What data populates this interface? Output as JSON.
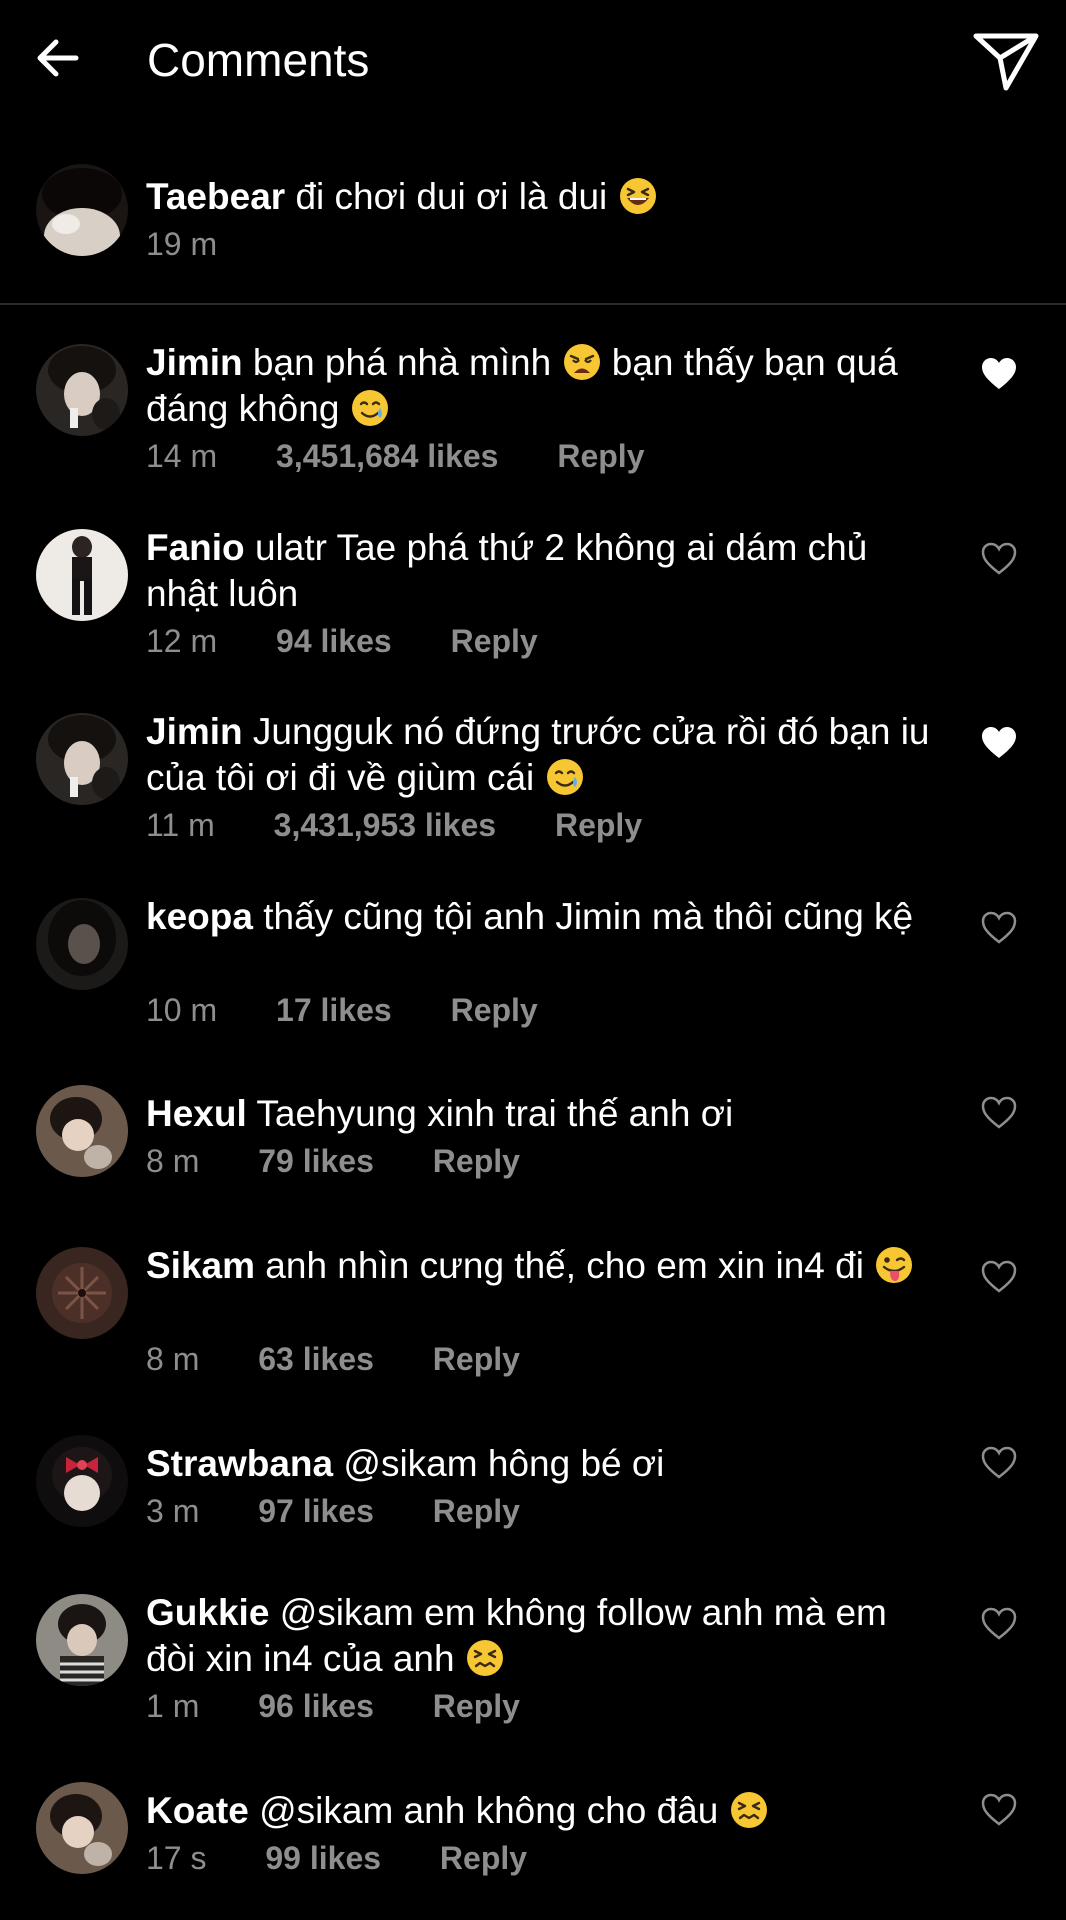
{
  "header": {
    "title": "Comments"
  },
  "caption": {
    "username": "Taebear",
    "text": "đi chơi dui ơi là dui",
    "emoji": "laughing-squint-emoji",
    "time": "19 m"
  },
  "comments": [
    {
      "username": "Jimin",
      "parts": [
        "bạn phá nhà mình",
        "bạn thấy bạn quá đáng không"
      ],
      "emojis": [
        "weary-emoji",
        "smiling-tear-emoji"
      ],
      "time": "14 m",
      "likes": "3,451,684 likes",
      "reply": "Reply",
      "liked": true
    },
    {
      "username": "Fanio",
      "parts": [
        "ulatr Tae phá thứ 2 không ai dám chủ nhật luôn"
      ],
      "emojis": [],
      "time": "12 m",
      "likes": "94 likes",
      "reply": "Reply",
      "liked": false
    },
    {
      "username": "Jimin",
      "parts": [
        "Jungguk nó đứng trước cửa rồi đó bạn iu của tôi ơi đi về giùm cái"
      ],
      "emojis": [
        "smiling-tear-emoji"
      ],
      "time": "11 m",
      "likes": "3,431,953 likes",
      "reply": "Reply",
      "liked": true
    },
    {
      "username": "keopa",
      "parts": [
        "thấy cũng tội anh Jimin mà thôi cũng kệ"
      ],
      "emojis": [],
      "time": "10 m",
      "likes": "17 likes",
      "reply": "Reply",
      "liked": false
    },
    {
      "username": "Hexul",
      "parts": [
        "Taehyung xinh trai thế anh ơi"
      ],
      "emojis": [],
      "time": "8 m",
      "likes": "79 likes",
      "reply": "Reply",
      "liked": false
    },
    {
      "username": "Sikam",
      "parts": [
        "anh nhìn cưng thế, cho em xin in4 đi"
      ],
      "emojis": [
        "tongue-wink-emoji"
      ],
      "time": "8 m",
      "likes": "63 likes",
      "reply": "Reply",
      "liked": false
    },
    {
      "username": "Strawbana",
      "parts": [
        "@sikam hông bé ơi"
      ],
      "emojis": [],
      "time": "3 m",
      "likes": "97 likes",
      "reply": "Reply",
      "liked": false
    },
    {
      "username": "Gukkie",
      "parts": [
        "@sikam em không follow anh mà em đòi xin in4 của anh"
      ],
      "emojis": [
        "confounded-emoji"
      ],
      "time": "1 m",
      "likes": "96 likes",
      "reply": "Reply",
      "liked": false
    },
    {
      "username": "Koate",
      "parts": [
        "@sikam anh không cho đâu"
      ],
      "emojis": [
        "confounded-emoji"
      ],
      "time": "17 s",
      "likes": "99 likes",
      "reply": "Reply",
      "liked": false
    }
  ],
  "colors": {
    "background": "#000000",
    "text": "#ffffff",
    "meta": "#8e8e8e",
    "emoji_yellow": "#f7c633"
  }
}
